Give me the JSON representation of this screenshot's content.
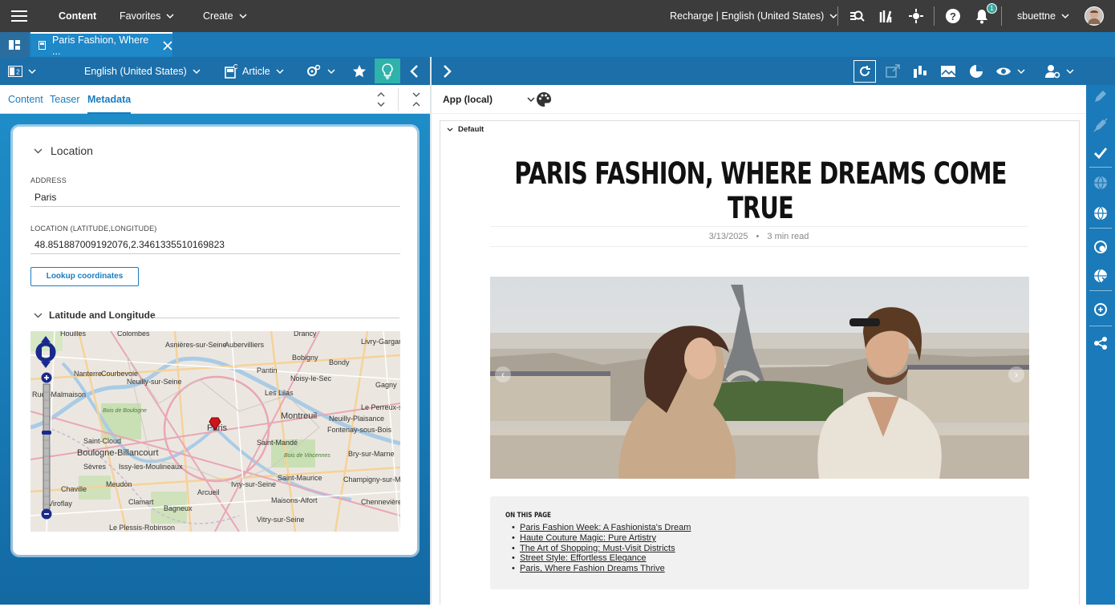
{
  "topbar": {
    "brand": "Content",
    "favorites": "Favorites",
    "create": "Create",
    "site": "Recharge | English (United States)",
    "notification_count": "1",
    "user": "sbuettne"
  },
  "tab": {
    "label": "Paris Fashion, Where ..."
  },
  "toolbar": {
    "locale": "English (United States)",
    "doctype": "Article"
  },
  "subtabs": [
    "Content",
    "Teaser",
    "Metadata"
  ],
  "location": {
    "section_title": "Location",
    "address_label": "ADDRESS",
    "address_value": "Paris",
    "coords_label": "LOCATION (LATITUDE,LONGITUDE)",
    "coords_value": "48.851887009192076,2.3461335510169823",
    "lookup_button": "Lookup coordinates",
    "latlng_title": "Latitude and Longitude"
  },
  "map": {
    "labels": [
      "Houilles",
      "Colombes",
      "Asnières-sur-Seine",
      "Aubervilliers",
      "Drancy",
      "Livry-Gargan",
      "Bobigny",
      "Bondy",
      "Pantin",
      "Noisy-le-Sec",
      "Nanterre",
      "Courbevoie",
      "Neuilly-sur-Seine",
      "Les Lilas",
      "Gagny",
      "Rueil-Malmaison",
      "Bois de Boulogne",
      "Paris",
      "Montreuil",
      "Neuilly-Plaisance",
      "Fontenay-sous-Bois",
      "Saint-Cloud",
      "Boulogne-Billancourt",
      "Saint-Mandé",
      "Bois de Vincennes",
      "Bry-sur-Marne",
      "Sèvres",
      "Issy-les-Moulineaux",
      "Champigny-sur-Marne",
      "Chaville",
      "Meudon",
      "Ivry-sur-Seine",
      "Saint-Maurice",
      "Le Plessis-Robinson",
      "Clamart",
      "Arcueil",
      "Maisons-Alfort",
      "Chennevières-sur-Marne",
      "Bagneux",
      "Vitry-sur-Seine",
      "Viroflay",
      "Le Perreux-sur-Marne"
    ]
  },
  "preview": {
    "device": "App (local)",
    "group": "Default",
    "title": "PARIS FASHION, WHERE DREAMS COME TRUE",
    "date": "3/13/2025",
    "dot": "•",
    "read_time": "3 min read",
    "toc_title": "ON THIS PAGE",
    "toc_items": [
      "Paris Fashion Week: A Fashionista's Dream",
      "Haute Couture Magic: Pure Artistry",
      "The Art of Shopping: Must-Visit Districts",
      "Street Style: Effortless Elegance",
      "Paris, Where Fashion Dreams Thrive"
    ]
  },
  "colors": {
    "topbar": "#3c3c3c",
    "tabrow": "#1c79b6",
    "toolbar": "#1c6fa8",
    "accent": "#1b7cc0",
    "active_tool": "#2fb2a9",
    "marker": "#d0141b"
  }
}
